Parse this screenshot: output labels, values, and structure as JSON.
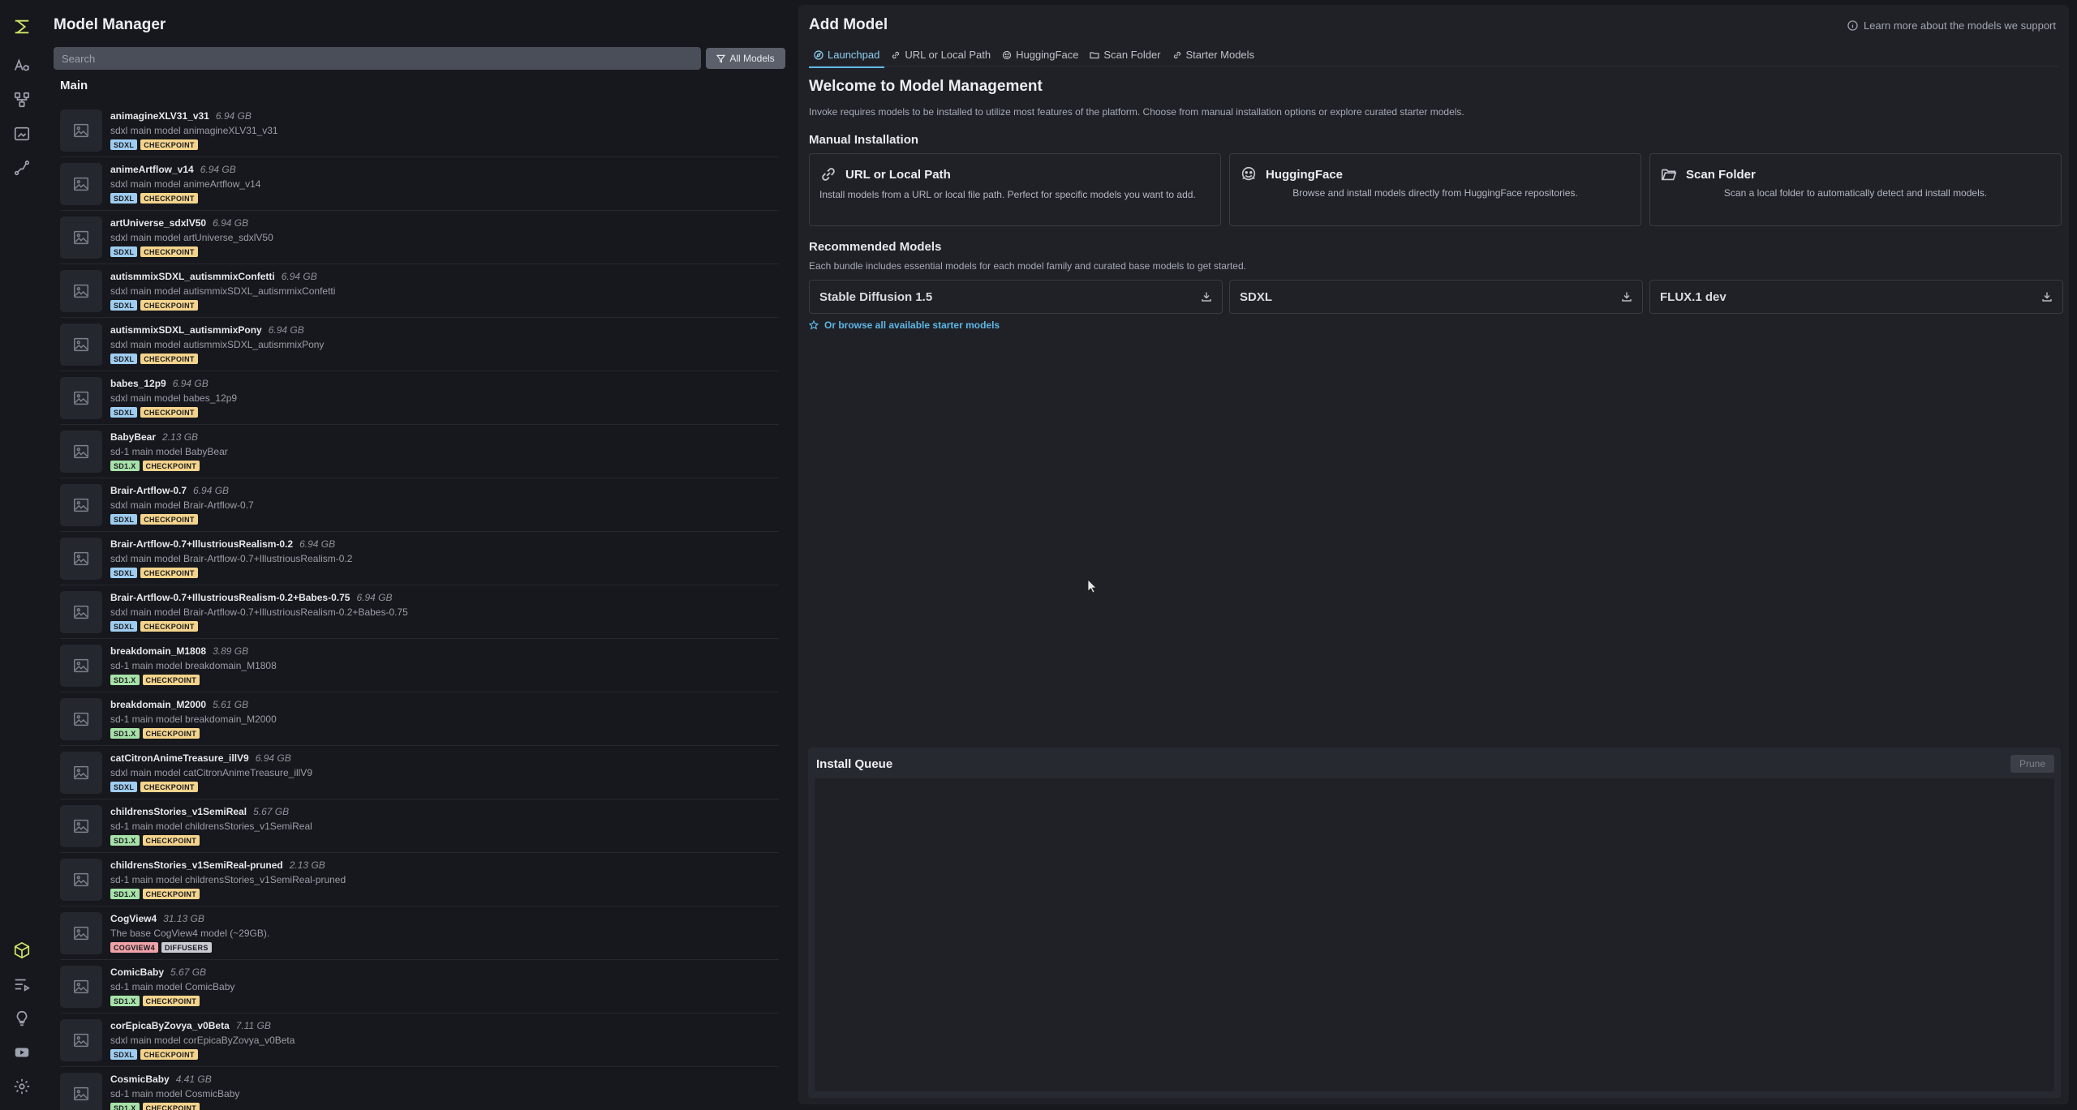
{
  "rail": {
    "top_icons": [
      "invoke-logo-icon",
      "text-style-icon",
      "workflow-nodes-icon",
      "canvas-frame-icon",
      "model-path-icon"
    ],
    "bottom_icons": [
      "models-cube-icon",
      "queue-list-icon",
      "lightbulb-icon",
      "youtube-icon",
      "gear-icon"
    ]
  },
  "left": {
    "title": "Model Manager",
    "search_placeholder": "Search",
    "filter_label": "All Models",
    "section": "Main",
    "models": [
      {
        "name": "animagineXLV31_v31",
        "size": "6.94 GB",
        "desc": "sdxl main model animagineXLV31_v31",
        "base": "SDXL",
        "format": "CHECKPOINT"
      },
      {
        "name": "animeArtflow_v14",
        "size": "6.94 GB",
        "desc": "sdxl main model animeArtflow_v14",
        "base": "SDXL",
        "format": "CHECKPOINT"
      },
      {
        "name": "artUniverse_sdxlV50",
        "size": "6.94 GB",
        "desc": "sdxl main model artUniverse_sdxlV50",
        "base": "SDXL",
        "format": "CHECKPOINT"
      },
      {
        "name": "autismmixSDXL_autismmixConfetti",
        "size": "6.94 GB",
        "desc": "sdxl main model autismmixSDXL_autismmixConfetti",
        "base": "SDXL",
        "format": "CHECKPOINT"
      },
      {
        "name": "autismmixSDXL_autismmixPony",
        "size": "6.94 GB",
        "desc": "sdxl main model autismmixSDXL_autismmixPony",
        "base": "SDXL",
        "format": "CHECKPOINT"
      },
      {
        "name": "babes_12p9",
        "size": "6.94 GB",
        "desc": "sdxl main model babes_12p9",
        "base": "SDXL",
        "format": "CHECKPOINT"
      },
      {
        "name": "BabyBear",
        "size": "2.13 GB",
        "desc": "sd-1 main model BabyBear",
        "base": "SD1.X",
        "format": "CHECKPOINT"
      },
      {
        "name": "Brair-Artflow-0.7",
        "size": "6.94 GB",
        "desc": "sdxl main model Brair-Artflow-0.7",
        "base": "SDXL",
        "format": "CHECKPOINT"
      },
      {
        "name": "Brair-Artflow-0.7+IllustriousRealism-0.2",
        "size": "6.94 GB",
        "desc": "sdxl main model Brair-Artflow-0.7+IllustriousRealism-0.2",
        "base": "SDXL",
        "format": "CHECKPOINT"
      },
      {
        "name": "Brair-Artflow-0.7+IllustriousRealism-0.2+Babes-0.75",
        "size": "6.94 GB",
        "desc": "sdxl main model Brair-Artflow-0.7+IllustriousRealism-0.2+Babes-0.75",
        "base": "SDXL",
        "format": "CHECKPOINT"
      },
      {
        "name": "breakdomain_M1808",
        "size": "3.89 GB",
        "desc": "sd-1 main model breakdomain_M1808",
        "base": "SD1.X",
        "format": "CHECKPOINT"
      },
      {
        "name": "breakdomain_M2000",
        "size": "5.61 GB",
        "desc": "sd-1 main model breakdomain_M2000",
        "base": "SD1.X",
        "format": "CHECKPOINT"
      },
      {
        "name": "catCitronAnimeTreasure_illV9",
        "size": "6.94 GB",
        "desc": "sdxl main model catCitronAnimeTreasure_illV9",
        "base": "SDXL",
        "format": "CHECKPOINT"
      },
      {
        "name": "childrensStories_v1SemiReal",
        "size": "5.67 GB",
        "desc": "sd-1 main model childrensStories_v1SemiReal",
        "base": "SD1.X",
        "format": "CHECKPOINT"
      },
      {
        "name": "childrensStories_v1SemiReal-pruned",
        "size": "2.13 GB",
        "desc": "sd-1 main model childrensStories_v1SemiReal-pruned",
        "base": "SD1.X",
        "format": "CHECKPOINT"
      },
      {
        "name": "CogView4",
        "size": "31.13 GB",
        "desc": "The base CogView4 model (~29GB).",
        "base": "COGVIEW4",
        "format": "DIFFUSERS"
      },
      {
        "name": "ComicBaby",
        "size": "5.67 GB",
        "desc": "sd-1 main model ComicBaby",
        "base": "SD1.X",
        "format": "CHECKPOINT"
      },
      {
        "name": "corEpicaByZovya_v0Beta",
        "size": "7.11 GB",
        "desc": "sdxl main model corEpicaByZovya_v0Beta",
        "base": "SDXL",
        "format": "CHECKPOINT"
      },
      {
        "name": "CosmicBaby",
        "size": "4.41 GB",
        "desc": "sd-1 main model CosmicBaby",
        "base": "SD1.X",
        "format": "CHECKPOINT"
      }
    ]
  },
  "right": {
    "title": "Add Model",
    "learn_more": "Learn more about the models we support",
    "tabs": [
      "Launchpad",
      "URL or Local Path",
      "HuggingFace",
      "Scan Folder",
      "Starter Models"
    ],
    "active_tab": "Launchpad",
    "welcome_title": "Welcome to Model Management",
    "welcome_sub": "Invoke requires models to be installed to utilize most features of the platform. Choose from manual installation options or explore curated starter models.",
    "manual_heading": "Manual Installation",
    "cards": [
      {
        "title": "URL or Local Path",
        "desc": "Install models from a URL or local file path. Perfect for specific models you want to add."
      },
      {
        "title": "HuggingFace",
        "desc": "Browse and install models directly from HuggingFace repositories."
      },
      {
        "title": "Scan Folder",
        "desc": "Scan a local folder to automatically detect and install models."
      }
    ],
    "recommended_heading": "Recommended Models",
    "recommended_sub": "Each bundle includes essential models for each model family and curated base models to get started.",
    "bundles": [
      "Stable Diffusion 1.5",
      "SDXL",
      "FLUX.1 dev"
    ],
    "browse_link": "Or browse all available starter models",
    "queue_title": "Install Queue",
    "prune_label": "Prune"
  },
  "colors": {
    "accent_blue": "#5eb9e6",
    "logo_yellow": "#d4e76a",
    "badge_sdxl": "#9fcdf0",
    "badge_sd1": "#a7e2a9",
    "badge_checkpoint": "#f4d48c",
    "badge_cogview": "#f0a2a8"
  }
}
